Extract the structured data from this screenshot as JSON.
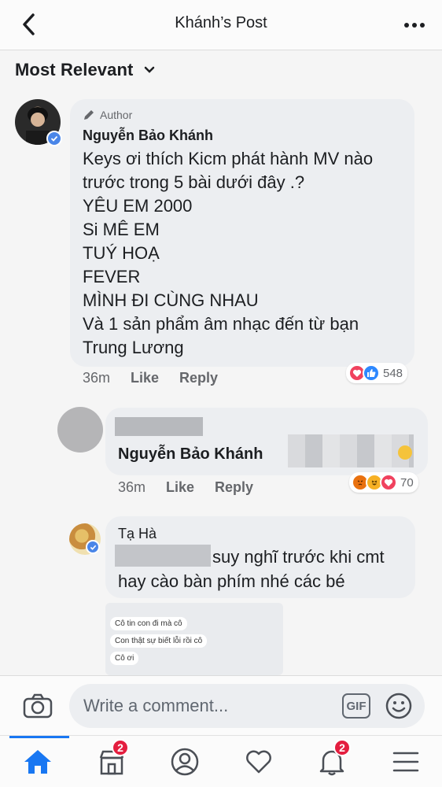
{
  "header": {
    "title": "Khánh’s Post",
    "back_icon": "chevron-left-icon",
    "more_icon": "more-dots-icon"
  },
  "sort": {
    "label": "Most Relevant",
    "icon": "chevron-down-icon"
  },
  "comments": [
    {
      "author_tag": "Author",
      "name": "Nguyễn Bảo Khánh",
      "lines": [
        "Keys ơi thích Kicm phát hành MV nào",
        "trước trong 5 bài dưới đây .?",
        "YÊU EM 2000",
        "Si MÊ EM",
        "TUÝ HOẠ",
        "FEVER",
        "MÌNH ĐI CÙNG NHAU",
        "Và 1 sản phẩm âm nhạc đến từ bạn",
        "Trung Lương"
      ],
      "time": "36m",
      "like": "Like",
      "reply": "Reply",
      "reaction_count": "548"
    },
    {
      "mention": "Nguyễn Bảo Khánh",
      "time": "36m",
      "like": "Like",
      "reply": "Reply",
      "reaction_count": "70"
    },
    {
      "name": "Tạ Hà",
      "line1": "suy nghĩ trước khi cmt",
      "line2": "hay cào bàn phím nhé các bé",
      "chat_preview": [
        "Cô tin con đi mà cô",
        "Con thật sự biết lỗi rồi cô",
        "Cô ơi"
      ]
    }
  ],
  "composer": {
    "placeholder": "Write a comment...",
    "gif_label": "GIF",
    "camera_icon": "camera-icon",
    "emoji_icon": "emoji-icon"
  },
  "tabs": [
    {
      "name": "home",
      "icon": "home-icon",
      "active": true
    },
    {
      "name": "marketplace",
      "icon": "shop-icon",
      "badge": "2"
    },
    {
      "name": "profile",
      "icon": "profile-icon"
    },
    {
      "name": "dating",
      "icon": "heart-icon"
    },
    {
      "name": "notifications",
      "icon": "bell-icon",
      "badge": "2"
    },
    {
      "name": "menu",
      "icon": "menu-icon"
    }
  ],
  "colors": {
    "accent": "#1877f2",
    "badge_red": "#e41e3f",
    "bubble_bg": "#eceef1"
  }
}
